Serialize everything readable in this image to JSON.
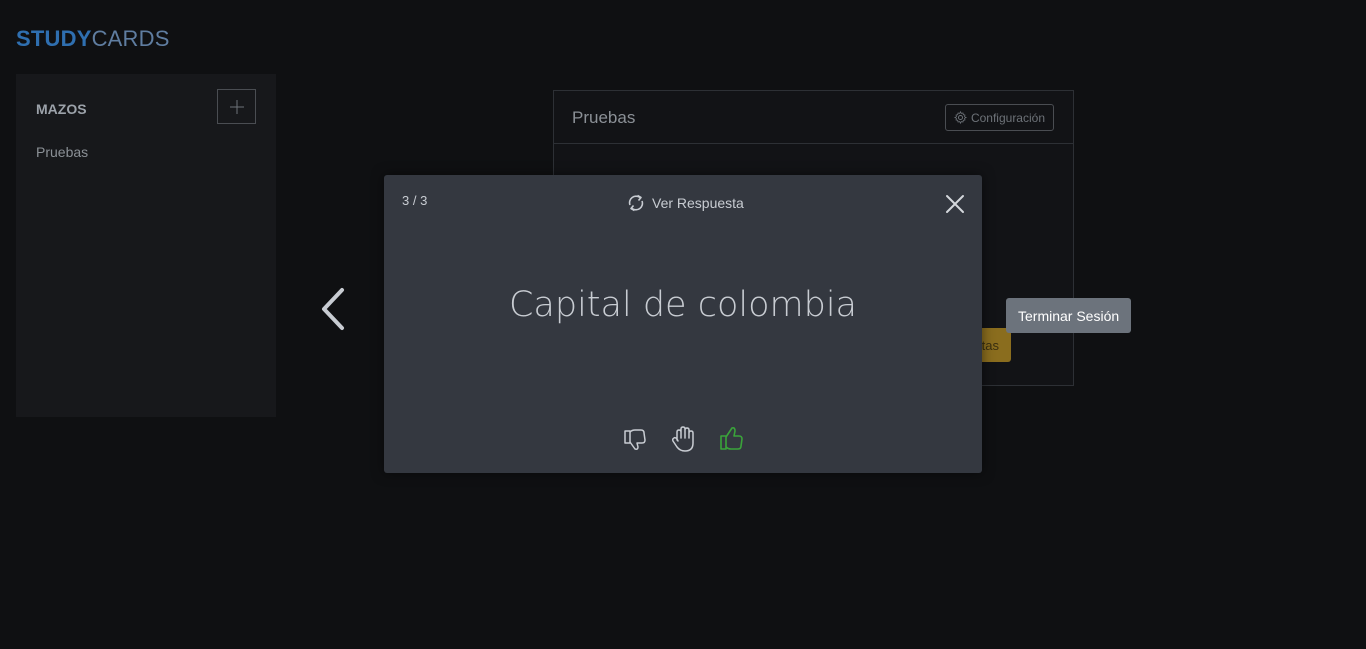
{
  "brand": {
    "bold": "STUDY",
    "light": "CARDS"
  },
  "sidebar": {
    "title": "MAZOS",
    "add_icon": "plus-icon",
    "items": [
      {
        "label": "Pruebas"
      }
    ]
  },
  "deck_panel": {
    "title": "Pruebas",
    "config_label": "Configuración",
    "config_icon": "gear-icon",
    "partial_button_text": "tas"
  },
  "card": {
    "counter": "3 / 3",
    "flip_label": "Ver Respuesta",
    "flip_icon": "refresh-icon",
    "close_icon": "close-icon",
    "question": "Capital de colombia",
    "ratings": [
      {
        "name": "thumbs-down-icon",
        "color": "#c8ccd2"
      },
      {
        "name": "hand-icon",
        "color": "#c8ccd2"
      },
      {
        "name": "thumbs-up-icon",
        "color": "#3aa33a"
      }
    ]
  },
  "nav": {
    "prev_icon": "chevron-left-icon"
  },
  "tooltip": {
    "text": "Terminar Sesión"
  },
  "colors": {
    "background": "#0f1012",
    "card": "#343840",
    "accent_blue": "#2f6fb0",
    "accent_green": "#3aa33a",
    "tooltip": "#6c737c"
  }
}
